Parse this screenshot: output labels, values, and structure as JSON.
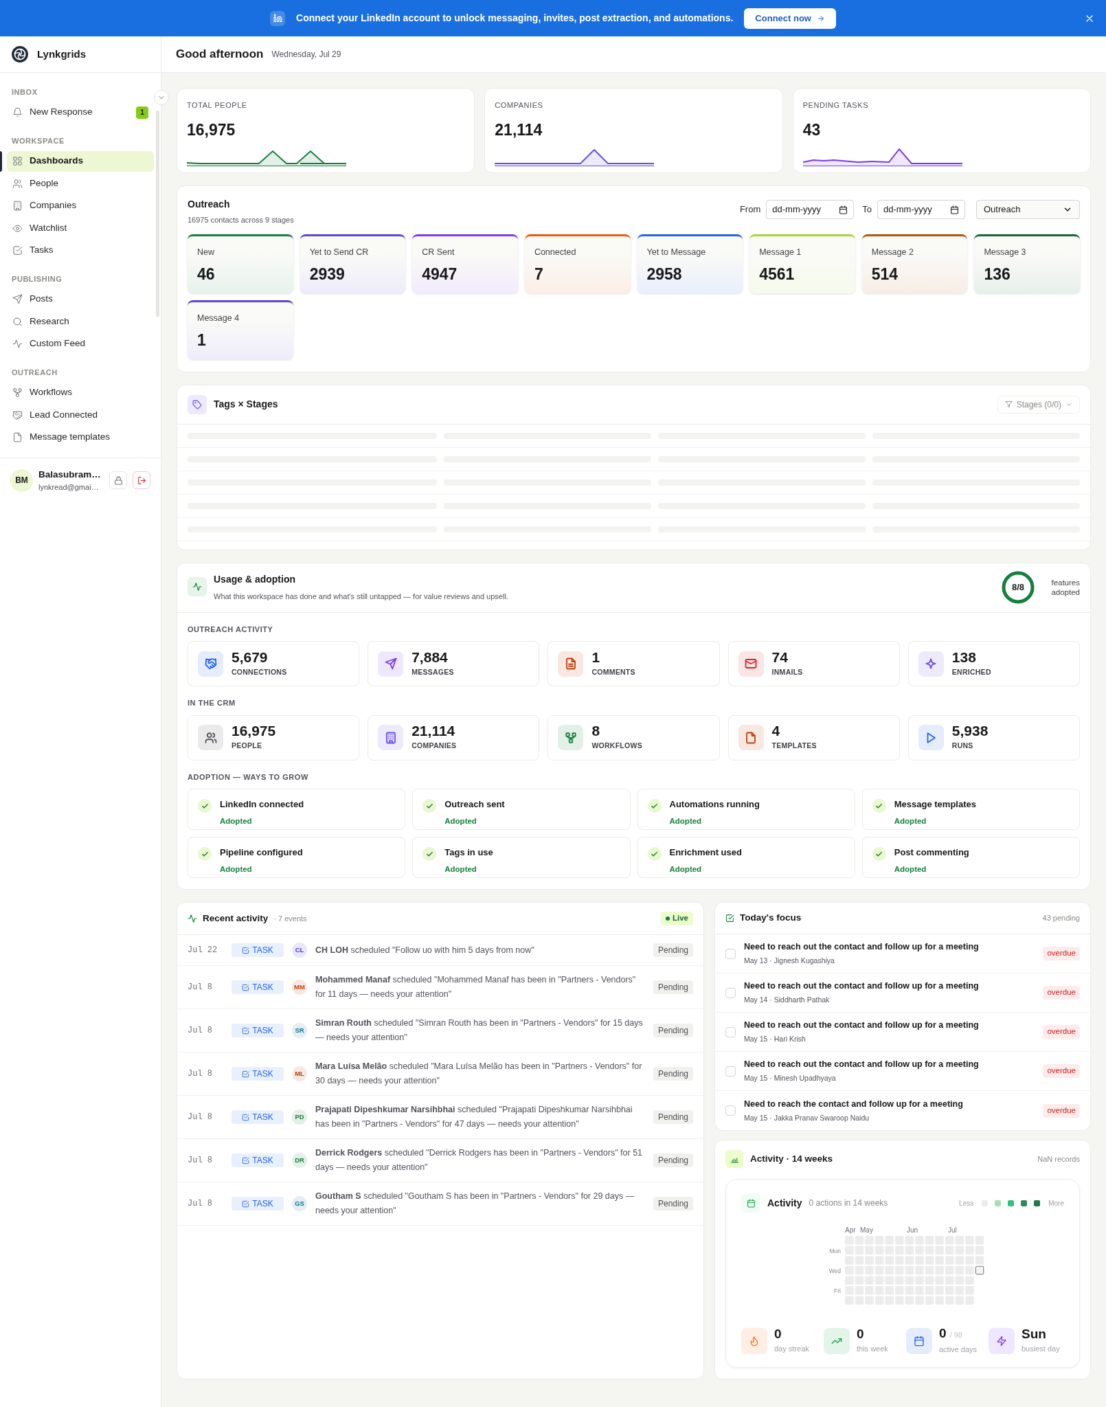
{
  "banner": {
    "message": "Connect your LinkedIn account to unlock messaging, invites, post extraction, and automations.",
    "button": "Connect now"
  },
  "sidebar": {
    "brand": "Lynkgrids",
    "sections": [
      {
        "title": "INBOX",
        "items": [
          {
            "label": "New Response",
            "badge": "1",
            "selected": false
          }
        ]
      },
      {
        "title": "WORKSPACE",
        "items": [
          {
            "label": "Dashboards",
            "selected": true
          },
          {
            "label": "People",
            "selected": false
          },
          {
            "label": "Companies",
            "selected": false
          },
          {
            "label": "Watchlist",
            "selected": false
          },
          {
            "label": "Tasks",
            "selected": false
          }
        ]
      },
      {
        "title": "PUBLISHING",
        "items": [
          {
            "label": "Posts",
            "selected": false
          },
          {
            "label": "Research",
            "selected": false
          },
          {
            "label": "Custom Feed",
            "selected": false
          }
        ]
      },
      {
        "title": "OUTREACH",
        "items": [
          {
            "label": "Workflows",
            "selected": false
          },
          {
            "label": "Lead Connected",
            "selected": false
          },
          {
            "label": "Message templates",
            "selected": false
          }
        ]
      }
    ],
    "user": {
      "initials": "BM",
      "name": "Balasubram…",
      "email": "lynkread@gmai…"
    }
  },
  "header": {
    "greeting": "Good afternoon",
    "date": "Wednesday, Jul 29"
  },
  "stats": [
    {
      "label": "TOTAL PEOPLE",
      "value": "16,975",
      "color": "#15803d"
    },
    {
      "label": "COMPANIES",
      "value": "21,114",
      "color": "#6d4fe0"
    },
    {
      "label": "PENDING TASKS",
      "value": "43",
      "color": "#7c3aed"
    }
  ],
  "outreach": {
    "title": "Outreach",
    "subtitle": "16975 contacts across 9 stages",
    "from_label": "From",
    "from_placeholder": "dd-mm-yyyy",
    "to_label": "To",
    "to_placeholder": "dd-mm-yyyy",
    "pipeline": "Outreach",
    "stages": [
      {
        "name": "New",
        "count": "46",
        "color": "#15803d"
      },
      {
        "name": "Yet to Send CR",
        "count": "2939",
        "color": "#5b45d6"
      },
      {
        "name": "CR Sent",
        "count": "4947",
        "color": "#7c3aed"
      },
      {
        "name": "Connected",
        "count": "7",
        "color": "#ea580c"
      },
      {
        "name": "Yet to Message",
        "count": "2958",
        "color": "#2563eb"
      },
      {
        "name": "Message 1",
        "count": "4561",
        "color": "#a3d635"
      },
      {
        "name": "Message 2",
        "count": "514",
        "color": "#b45309"
      },
      {
        "name": "Message 3",
        "count": "136",
        "color": "#166534"
      },
      {
        "name": "Message 4",
        "count": "1",
        "color": "#5b45d6"
      }
    ]
  },
  "tags_stages": {
    "title": "Tags × Stages",
    "filter": "Stages (0/0)",
    "loading": true
  },
  "usage": {
    "title": "Usage & adoption",
    "subtitle": "What this workspace has done and what's still untapped — for value reviews and upsell.",
    "adopted": "8/8",
    "level": 1,
    "adopted_label": "features adopted",
    "sections": [
      {
        "title": "OUTREACH ACTIVITY",
        "metrics": [
          {
            "value": "5,679",
            "label": "CONNECTIONS",
            "color": "#2563eb"
          },
          {
            "value": "7,884",
            "label": "MESSAGES",
            "color": "#7c3aed"
          },
          {
            "value": "1",
            "label": "COMMENTS",
            "color": "#c2410c"
          },
          {
            "value": "74",
            "label": "INMAILS",
            "color": "#dc2626"
          },
          {
            "value": "138",
            "label": "ENRICHED",
            "color": "#6d4fe0"
          }
        ]
      },
      {
        "title": "IN THE CRM",
        "metrics": [
          {
            "value": "16,975",
            "label": "PEOPLE",
            "color": "#52525b"
          },
          {
            "value": "21,114",
            "label": "COMPANIES",
            "color": "#6d4fe0"
          },
          {
            "value": "8",
            "label": "WORKFLOWS",
            "color": "#15803d"
          },
          {
            "value": "4",
            "label": "TEMPLATES",
            "color": "#c2410c"
          },
          {
            "value": "5,938",
            "label": "RUNS",
            "color": "#2563eb"
          }
        ]
      }
    ],
    "adoption_title": "ADOPTION — WAYS TO GROW",
    "adoption": [
      {
        "name": "LinkedIn connected",
        "status": "Adopted",
        "adopted": true
      },
      {
        "name": "Outreach sent",
        "status": "Adopted",
        "adopted": true
      },
      {
        "name": "Automations running",
        "status": "Adopted",
        "adopted": true
      },
      {
        "name": "Message templates",
        "status": "Adopted",
        "adopted": true
      },
      {
        "name": "Pipeline configured",
        "status": "Adopted",
        "adopted": true
      },
      {
        "name": "Tags in use",
        "status": "Adopted",
        "adopted": true
      },
      {
        "name": "Enrichment used",
        "status": "Adopted",
        "adopted": true
      },
      {
        "name": "Post commenting",
        "status": "Adopted",
        "adopted": true
      }
    ]
  },
  "recent_activity": {
    "title": "Recent activity",
    "count": "· 7 events",
    "live": "Live",
    "events": [
      {
        "date": "Jul 22",
        "tag": "TASK",
        "initials": "CL",
        "color": "#4338ca",
        "text": "**CH LOH** scheduled \"Follow uo with him 5 days from now\"",
        "status": "Pending"
      },
      {
        "date": "Jul 8",
        "tag": "TASK",
        "initials": "MM",
        "color": "#c2410c",
        "text": "**Mohammed Manaf** scheduled \"Mohammed Manaf has been in \"Partners - Vendors\" for 11 days — needs your attention\"",
        "status": "Pending"
      },
      {
        "date": "Jul 8",
        "tag": "TASK",
        "initials": "SR",
        "color": "#0e7490",
        "text": "**Simran Routh** scheduled \"Simran Routh has been in \"Partners - Vendors\" for 15 days — needs your attention\"",
        "status": "Pending"
      },
      {
        "date": "Jul 8",
        "tag": "TASK",
        "initials": "ML",
        "color": "#c2410c",
        "text": "**Mara Luísa Melão** scheduled \"Mara Luísa Melão has been in \"Partners - Vendors\" for 30 days — needs your attention\"",
        "status": "Pending"
      },
      {
        "date": "Jul 8",
        "tag": "TASK",
        "initials": "PD",
        "color": "#15803d",
        "text": "**Prajapati Dipeshkumar Narsihbhai** scheduled \"Prajapati Dipeshkumar Narsihbhai has been in \"Partners - Vendors\" for 47 days — needs your attention\"",
        "status": "Pending"
      },
      {
        "date": "Jul 8",
        "tag": "TASK",
        "initials": "DR",
        "color": "#15803d",
        "text": "**Derrick Rodgers** scheduled \"Derrick Rodgers has been in \"Partners - Vendors\" for 51 days — needs your attention\"",
        "status": "Pending"
      },
      {
        "date": "Jul 8",
        "tag": "TASK",
        "initials": "GS",
        "color": "#0e7490",
        "text": "**Goutham S** scheduled \"Goutham S has been in \"Partners - Vendors\" for 29 days — needs your attention\"",
        "status": "Pending"
      }
    ]
  },
  "todays_focus": {
    "title": "Today's focus",
    "count": "43 pending",
    "tasks": [
      {
        "title": "Need to reach out the contact and follow up for a meeting",
        "meta": "May 13 · Jignesh Kugashiya",
        "checked": false,
        "badge": "overdue"
      },
      {
        "title": "Need to reach out the contact and follow up for a meeting",
        "meta": "May 14 · Siddharth Pathak",
        "checked": false,
        "badge": "overdue"
      },
      {
        "title": "Need to reach out the contact and follow up for a meeting",
        "meta": "May 15 · Hari Krish",
        "checked": false,
        "badge": "overdue"
      },
      {
        "title": "Need to reach out the contact and follow up for a meeting",
        "meta": "May 15 · Minesh Upadhyaya",
        "checked": false,
        "badge": "overdue"
      },
      {
        "title": "Need to reach the contact and follow up for a meeting",
        "meta": "May 15 · Jakka Pranav Swaroop Naidu",
        "checked": false,
        "badge": "overdue"
      }
    ]
  },
  "activity": {
    "title": "Activity · 14 weeks",
    "records": "NaN records",
    "panel_title": "Activity",
    "summary": "0 actions in 14 weeks",
    "less": "Less",
    "more": "More",
    "legend": [
      {
        "color": "#ececec"
      },
      {
        "color": "#a7dfb8"
      },
      {
        "color": "#34c27a"
      },
      {
        "color": "#2f8a55"
      },
      {
        "color": "#1f7a45"
      }
    ],
    "months": [
      "Apr",
      "May",
      "Jun",
      "Jul"
    ],
    "days": [
      "Mon",
      "Wed",
      "Fri"
    ],
    "stats": [
      {
        "value": "0",
        "label": "day streak",
        "color": "#f97316"
      },
      {
        "value": "0",
        "label": "this week",
        "color": "#16a34a"
      },
      {
        "value": "0",
        "total": "/ 98",
        "label": "active days",
        "color": "#2563eb"
      },
      {
        "value": "Sun",
        "label": "busiest day",
        "color": "#7c3aed"
      }
    ]
  }
}
